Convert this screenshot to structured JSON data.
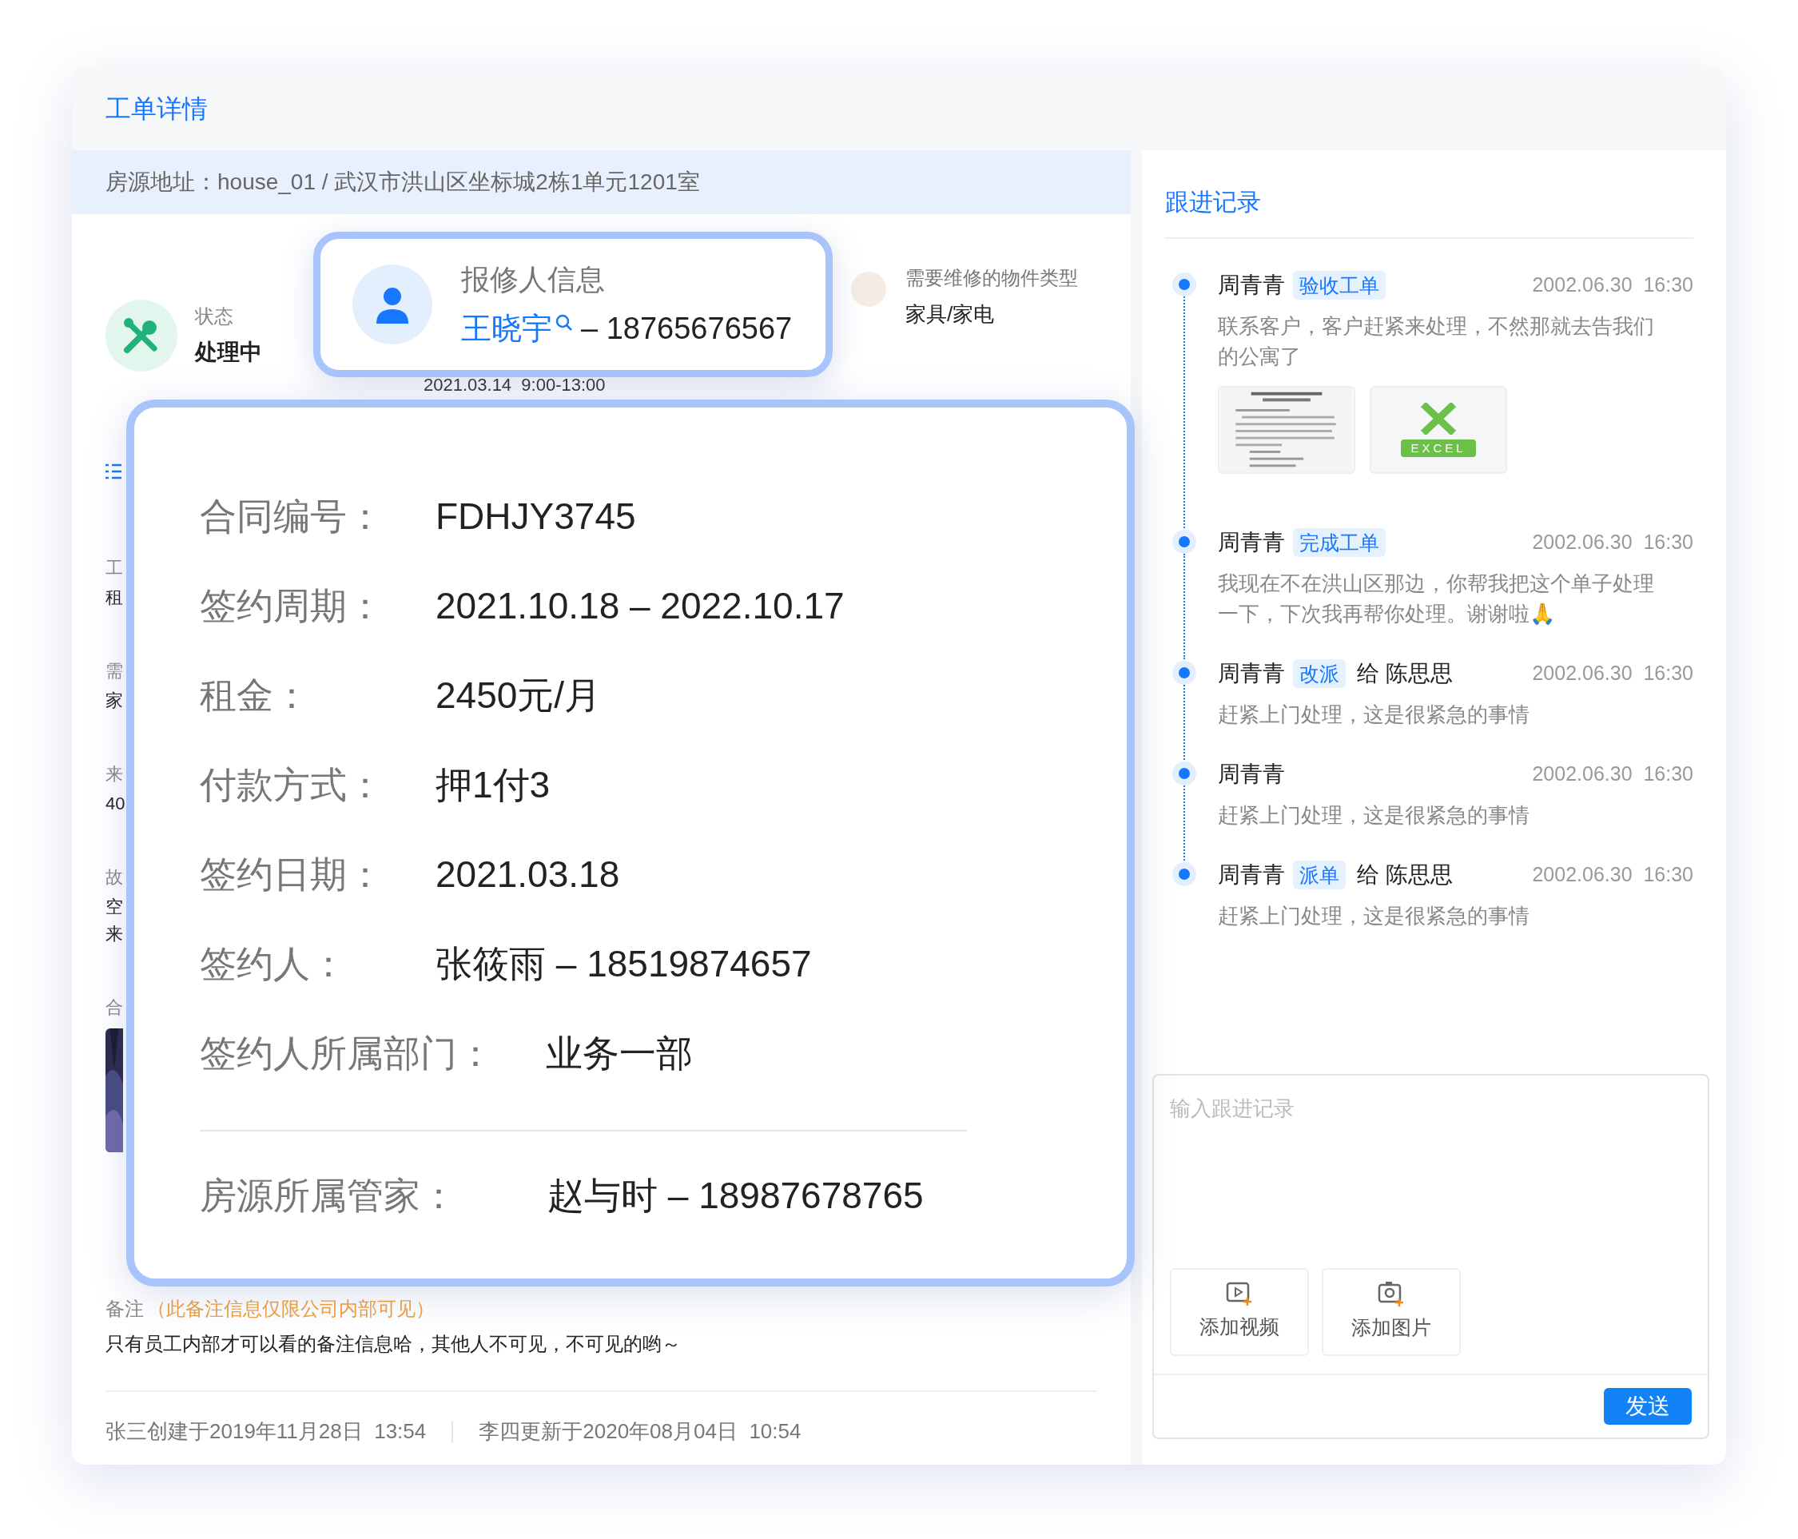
{
  "page_title": "工单详情",
  "address": "房源地址：house_01 / 武汉市洪山区坐标城2栋1单元1201室",
  "status": {
    "label": "状态",
    "value": "处理中"
  },
  "item_type": {
    "label": "需要维修的物件类型",
    "value": "家具/家电"
  },
  "appointment": "2021.03.14  9:00-13:00",
  "obscured_fields": [
    {
      "label": "工",
      "values": [
        "租"
      ]
    },
    {
      "label": "需",
      "values": [
        "家"
      ]
    },
    {
      "label": "来",
      "values": [
        "40"
      ]
    },
    {
      "label": "故",
      "values": [
        "空",
        "来"
      ]
    },
    {
      "label": "合",
      "kind": "picture"
    }
  ],
  "remark": {
    "label": "备注",
    "note": "（此备注信息仅限公司内部可见）",
    "text": "只有员工内部才可以看的备注信息哈，其他人不可见，不可见的哟～"
  },
  "footer": [
    "张三创建于2019年11月28日  13:54",
    "李四更新于2020年08月04日  10:54"
  ],
  "reporter": {
    "title": "报修人信息",
    "name": "王晓宇",
    "phone": "– 18765676567"
  },
  "contract": {
    "rows": [
      {
        "label": "合同编号：",
        "value": "FDHJY3745"
      },
      {
        "label": "签约周期：",
        "value": "2021.10.18 – 2022.10.17"
      },
      {
        "label": "租金：",
        "value": "2450元/月"
      },
      {
        "label": "付款方式：",
        "value": "押1付3"
      },
      {
        "label": "签约日期：",
        "value": "2021.03.18"
      },
      {
        "label": "签约人：",
        "value": "张筱雨 – 18519874657"
      },
      {
        "label": "签约人所属部门：",
        "value": "业务一部"
      }
    ],
    "manager": {
      "label": "房源所属管家：",
      "value": "赵与时 – 18987678765"
    }
  },
  "follow_up": {
    "title": "跟进记录",
    "entries": [
      {
        "author": "周青青",
        "tag": "验收工单",
        "time": "2002.06.30  16:30",
        "text": "联系客户，客户赶紧来处理，不然那就去告我们的公寓了",
        "attachments": [
          {
            "kind": "picture"
          },
          {
            "kind": "excel",
            "label": "EXCEL"
          }
        ]
      },
      {
        "author": "周青青",
        "tag": "完成工单",
        "time": "2002.06.30  16:30",
        "text": "我现在不在洪山区那边，你帮我把这个单子处理一下，下次我再帮你处理。谢谢啦🙏"
      },
      {
        "author": "周青青",
        "tag": "改派",
        "target": "给 陈思思",
        "time": "2002.06.30  16:30",
        "text": "赶紧上门处理，这是很紧急的事情"
      },
      {
        "author": "周青青",
        "time": "2002.06.30  16:30",
        "text": "赶紧上门处理，这是很紧急的事情"
      },
      {
        "author": "周青青",
        "tag": "派单",
        "target": "给 陈思思",
        "time": "2002.06.30  16:30",
        "text": "赶紧上门处理，这是很紧急的事情"
      }
    ],
    "input": {
      "placeholder": "输入跟进记录"
    },
    "media_buttons": [
      {
        "kind": "video",
        "label": "添加视频"
      },
      {
        "label": "添加图片"
      }
    ],
    "send": "发送"
  }
}
